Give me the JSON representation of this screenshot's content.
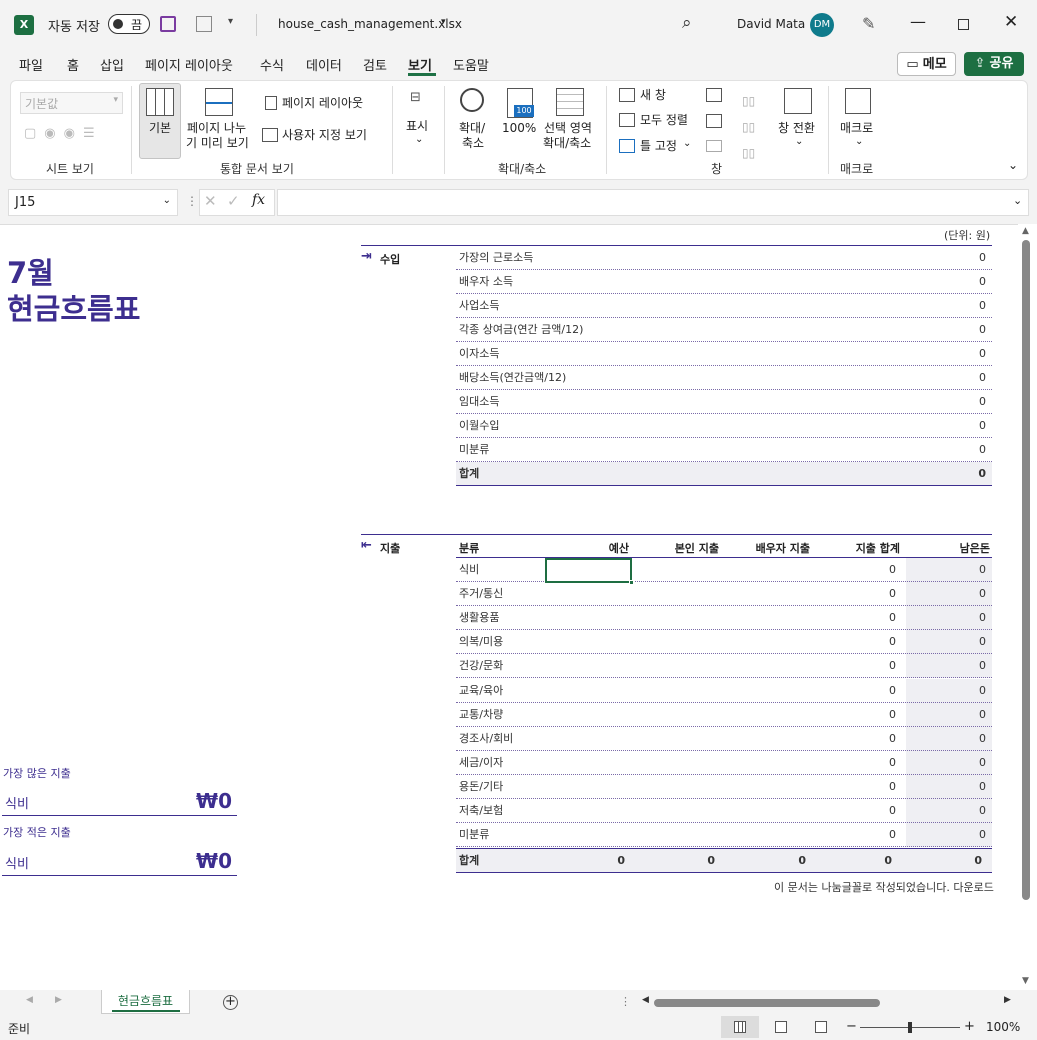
{
  "titlebar": {
    "autosave_label": "자동 저장",
    "toggle_state": "끔",
    "filename": "house_cash_management.xlsx",
    "user_name": "David Mata",
    "user_initials": "DM"
  },
  "tabs": [
    "파일",
    "홈",
    "삽입",
    "페이지 레이아웃",
    "수식",
    "데이터",
    "검토",
    "보기",
    "도움말"
  ],
  "active_tab": "보기",
  "buttons": {
    "memo": "메모",
    "share": "공유"
  },
  "ribbon": {
    "sheet_view_select": "기본값",
    "sheet_view_group": "시트 보기",
    "normal": "기본",
    "page_break_line1": "페이지 나누",
    "page_break_line2": "기 미리 보기",
    "page_layout": "페이지 레이아웃",
    "custom_view": "사용자 지정 보기",
    "workbook_views_group": "통합 문서 보기",
    "show": "표시",
    "zoom_line1": "확대/",
    "zoom_line2": "축소",
    "zoom100": "100%",
    "zoom_sel_line1": "선택 영역",
    "zoom_sel_line2": "확대/축소",
    "zoom_group": "확대/축소",
    "new_window": "새 창",
    "arrange_all": "모두 정렬",
    "freeze": "틀 고정",
    "switch_window": "창 전환",
    "window_group": "창",
    "macro": "매크로",
    "macro_group": "매크로"
  },
  "formula_bar": {
    "name_box": "J15",
    "fx": "fx",
    "formula": ""
  },
  "sheet": {
    "unit": "(단위: 원)",
    "title_month": "7월",
    "title_main": "현금흐름표",
    "income_label": "수입",
    "income_rows": [
      {
        "label": "가장의 근로소득",
        "value": "0"
      },
      {
        "label": "배우자 소득",
        "value": "0"
      },
      {
        "label": "사업소득",
        "value": "0"
      },
      {
        "label": "각종 상여금(연간 금액/12)",
        "value": "0"
      },
      {
        "label": "이자소득",
        "value": "0"
      },
      {
        "label": "배당소득(연간금액/12)",
        "value": "0"
      },
      {
        "label": "임대소득",
        "value": "0"
      },
      {
        "label": "이월수입",
        "value": "0"
      },
      {
        "label": "미분류",
        "value": "0"
      }
    ],
    "income_total": {
      "label": "합계",
      "value": "0"
    },
    "expense_label": "지출",
    "expense_headers": [
      "분류",
      "예산",
      "본인 지출",
      "배우자 지출",
      "지출 합계",
      "남은돈"
    ],
    "expense_rows": [
      {
        "label": "식비",
        "total": "0",
        "remain": "0"
      },
      {
        "label": "주거/통신",
        "total": "0",
        "remain": "0"
      },
      {
        "label": "생활용품",
        "total": "0",
        "remain": "0"
      },
      {
        "label": "의복/미용",
        "total": "0",
        "remain": "0"
      },
      {
        "label": "건강/문화",
        "total": "0",
        "remain": "0"
      },
      {
        "label": "교육/육아",
        "total": "0",
        "remain": "0"
      },
      {
        "label": "교통/차량",
        "total": "0",
        "remain": "0"
      },
      {
        "label": "경조사/회비",
        "total": "0",
        "remain": "0"
      },
      {
        "label": "세금/이자",
        "total": "0",
        "remain": "0"
      },
      {
        "label": "용돈/기타",
        "total": "0",
        "remain": "0"
      },
      {
        "label": "저축/보험",
        "total": "0",
        "remain": "0"
      },
      {
        "label": "미분류",
        "total": "0",
        "remain": "0"
      }
    ],
    "expense_total": {
      "label": "합계",
      "budget": "0",
      "mine": "0",
      "spouse": "0",
      "total": "0",
      "remain": "0"
    },
    "footer_note": "이 문서는 나눔글꼴로 작성되었습니다. 다운로드",
    "most_label": "가장 많은 지출",
    "most_category": "식비",
    "most_amount": "₩0",
    "least_label": "가장 적은 지출",
    "least_category": "식비",
    "least_amount": "₩0"
  },
  "sheet_tab": "현금흐름표",
  "status": {
    "ready": "준비",
    "zoom": "100%"
  }
}
